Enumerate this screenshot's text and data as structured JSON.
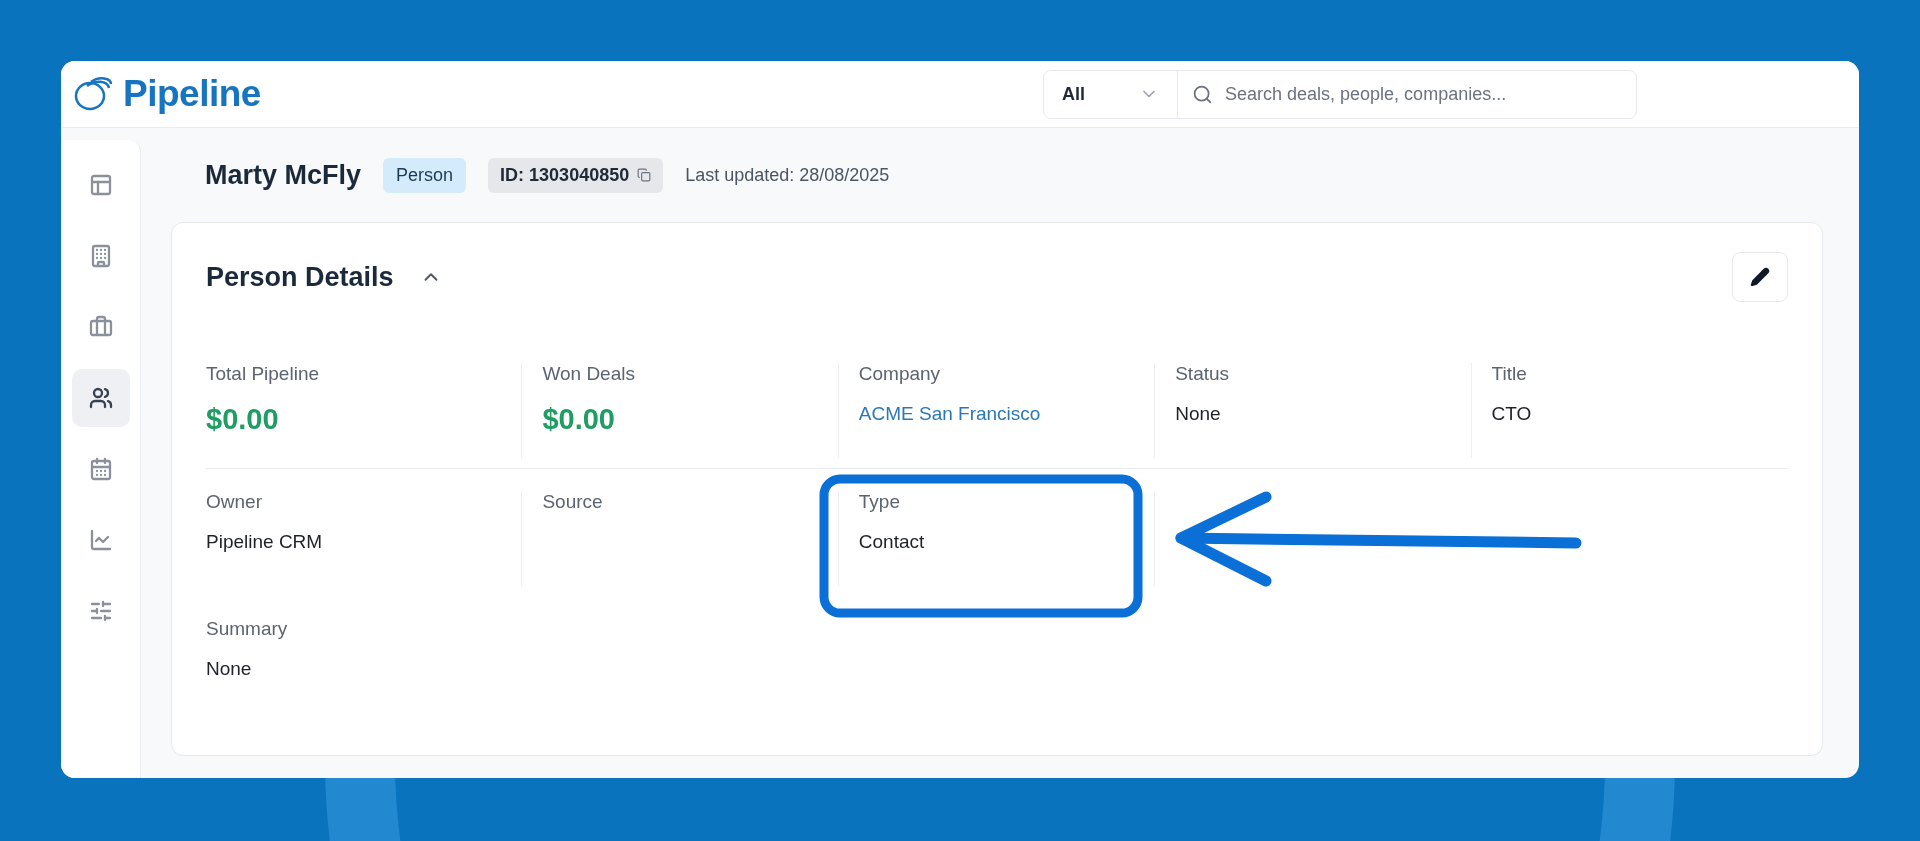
{
  "header": {
    "logo": "Pipeline",
    "search": {
      "scope": "All",
      "placeholder": "Search deals, people, companies..."
    }
  },
  "sidebar": {
    "items": [
      {
        "kind": "panels",
        "selected": false
      },
      {
        "kind": "building",
        "selected": false
      },
      {
        "kind": "briefcase",
        "selected": false
      },
      {
        "kind": "people",
        "selected": true
      },
      {
        "kind": "calendar",
        "selected": false
      },
      {
        "kind": "chart",
        "selected": false
      },
      {
        "kind": "sliders",
        "selected": false
      }
    ]
  },
  "record": {
    "name": "Marty McFly",
    "badge": "Person",
    "id": "ID: 1303040850",
    "last_updated": "Last updated: 28/08/2025"
  },
  "card": {
    "title": "Person Details",
    "expanded": true,
    "rows": [
      [
        {
          "label": "Total Pipeline",
          "value": "$0.00",
          "kind": "money"
        },
        {
          "label": "Won Deals",
          "value": "$0.00",
          "kind": "money"
        },
        {
          "label": "Company",
          "value": "ACME San Francisco",
          "kind": "link"
        },
        {
          "label": "Status",
          "value": "None",
          "kind": "text"
        },
        {
          "label": "Title",
          "value": "CTO",
          "kind": "text"
        }
      ],
      [
        {
          "label": "Owner",
          "value": "Pipeline CRM",
          "kind": "text"
        },
        {
          "label": "Source",
          "kind": "text"
        },
        {
          "label": "Type",
          "value": "Contact",
          "kind": "text",
          "highlighted": true
        }
      ],
      [
        {
          "label": "Summary",
          "value": "None",
          "kind": "text"
        }
      ]
    ]
  }
}
